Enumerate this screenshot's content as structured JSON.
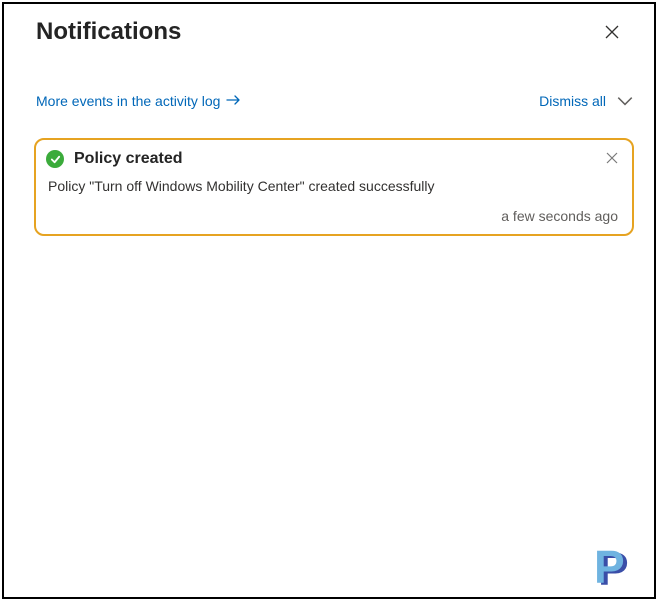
{
  "header": {
    "title": "Notifications"
  },
  "actions": {
    "more_events": "More events in the activity log",
    "dismiss_all": "Dismiss all"
  },
  "notifications": [
    {
      "title": "Policy created",
      "message": "Policy \"Turn off Windows Mobility Center\" created successfully",
      "timestamp": "a few seconds ago",
      "status": "success"
    }
  ],
  "brand": {
    "letter": "P"
  }
}
